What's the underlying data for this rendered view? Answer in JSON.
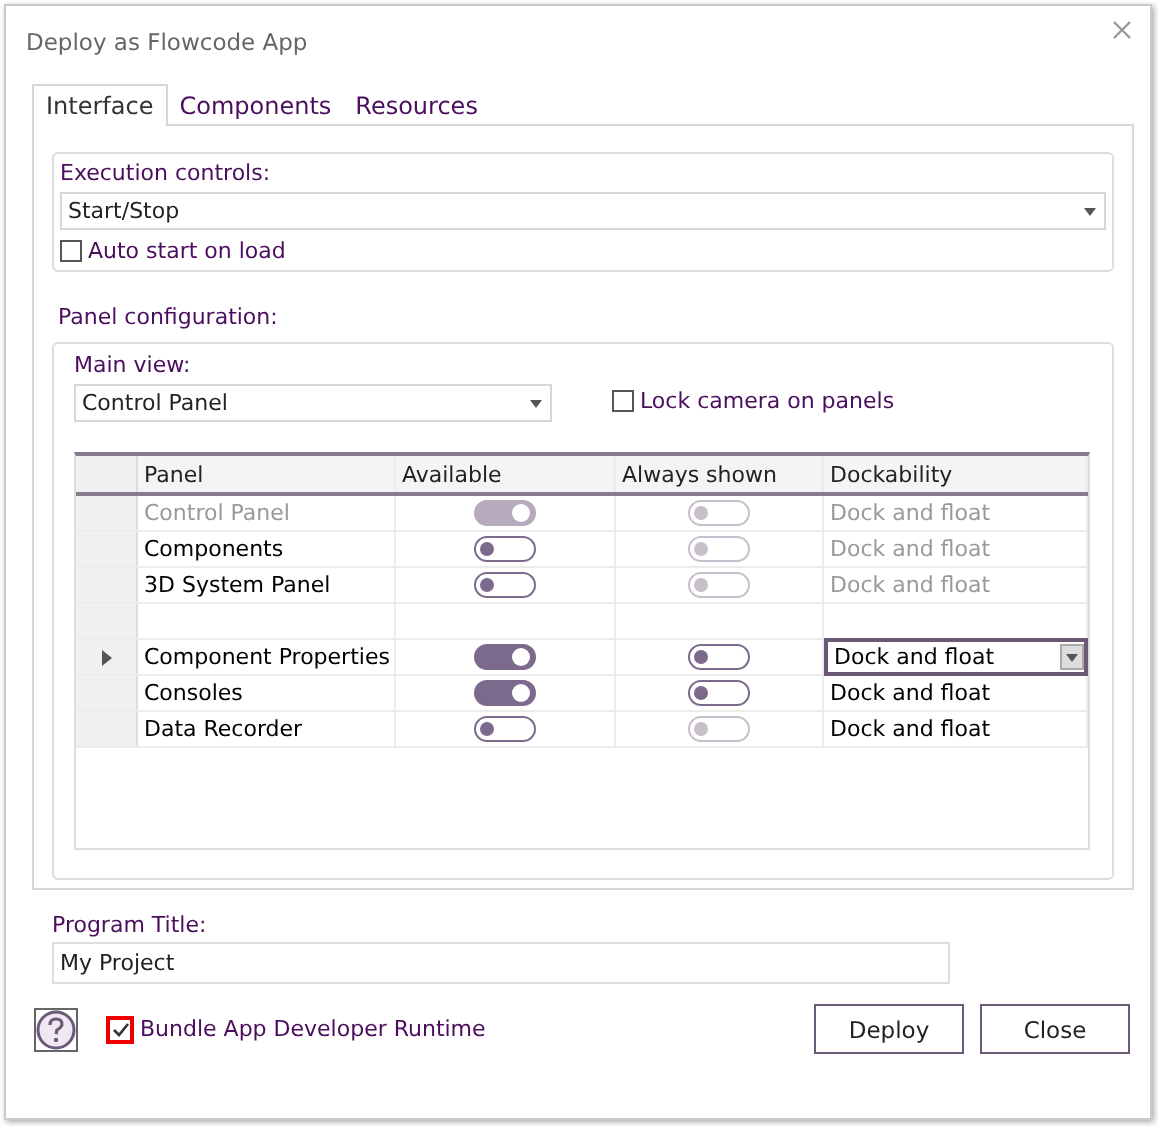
{
  "window": {
    "title": "Deploy as Flowcode App"
  },
  "tabs": [
    {
      "label": "Interface",
      "selected": true
    },
    {
      "label": "Components",
      "selected": false
    },
    {
      "label": "Resources",
      "selected": false
    }
  ],
  "execution": {
    "label": "Execution controls:",
    "value": "Start/Stop",
    "auto_start": {
      "label": "Auto start on load",
      "checked": false
    }
  },
  "panel_configuration": {
    "label": "Panel configuration:",
    "main_view": {
      "label": "Main view:",
      "value": "Control Panel"
    },
    "lock_camera": {
      "label": "Lock camera on panels",
      "checked": false
    },
    "table": {
      "columns": [
        "Panel",
        "Available",
        "Always shown",
        "Dockability"
      ],
      "rows": [
        {
          "kind": "panel",
          "current": false,
          "panel": "Control Panel",
          "panel_disabled": true,
          "available": {
            "on": true,
            "disabled": true
          },
          "always_shown": {
            "on": false,
            "disabled": true
          },
          "dockability": "Dock and float",
          "dock_disabled": true
        },
        {
          "kind": "panel",
          "current": false,
          "panel": "Components",
          "panel_disabled": false,
          "available": {
            "on": false,
            "disabled": false
          },
          "always_shown": {
            "on": false,
            "disabled": true
          },
          "dockability": "Dock and float",
          "dock_disabled": true
        },
        {
          "kind": "panel",
          "current": false,
          "panel": "3D System Panel",
          "panel_disabled": false,
          "available": {
            "on": false,
            "disabled": false
          },
          "always_shown": {
            "on": false,
            "disabled": true
          },
          "dockability": "Dock and float",
          "dock_disabled": true
        },
        {
          "kind": "blank",
          "current": false
        },
        {
          "kind": "panel",
          "current": true,
          "panel": "Component Properties",
          "panel_disabled": false,
          "available": {
            "on": true,
            "disabled": false
          },
          "always_shown": {
            "on": false,
            "disabled": false
          },
          "dockability": "Dock and float",
          "dock_disabled": false
        },
        {
          "kind": "panel",
          "current": false,
          "panel": "Consoles",
          "panel_disabled": false,
          "available": {
            "on": true,
            "disabled": false
          },
          "always_shown": {
            "on": false,
            "disabled": false
          },
          "dockability": "Dock and float",
          "dock_disabled": false
        },
        {
          "kind": "panel",
          "current": false,
          "panel": "Data Recorder",
          "panel_disabled": false,
          "available": {
            "on": false,
            "disabled": false
          },
          "always_shown": {
            "on": false,
            "disabled": true
          },
          "dockability": "Dock and float",
          "dock_disabled": false
        }
      ]
    }
  },
  "program_title": {
    "label": "Program Title:",
    "value": "My Project"
  },
  "bundle_runtime": {
    "label": "Bundle App Developer Runtime",
    "checked": true
  },
  "buttons": [
    "Deploy",
    "Close"
  ]
}
